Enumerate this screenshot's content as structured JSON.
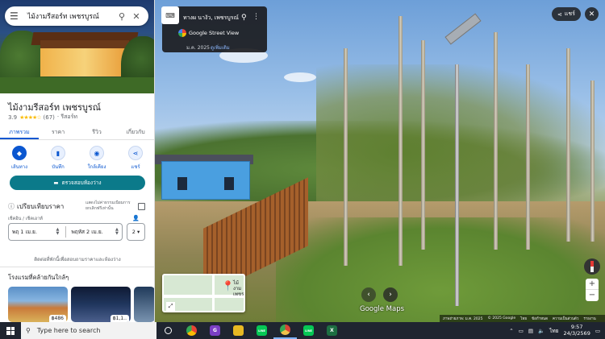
{
  "search": {
    "query": "ไม้งามรีสอร์ท เพชรบูรณ์",
    "menu_icon": "menu-icon",
    "search_icon": "search-icon",
    "close_icon": "close-icon"
  },
  "place": {
    "name": "ไม้งามรีสอร์ท เพชรบูรณ์",
    "rating": "3.9",
    "stars": "★★★★☆",
    "reviews": "(67)",
    "category": "· รีสอร์ท"
  },
  "tabs": [
    "ภาพรวม",
    "ราคา",
    "รีวิว",
    "เกี่ยวกับ"
  ],
  "actions": [
    {
      "label": "เส้นทาง",
      "icon": "directions-icon"
    },
    {
      "label": "บันทึก",
      "icon": "bookmark-icon"
    },
    {
      "label": "ใกล้เคียง",
      "icon": "nearby-icon"
    },
    {
      "label": "แชร์",
      "icon": "share-icon"
    }
  ],
  "check_button": "ตรวจสอบห้องว่าง",
  "compare": {
    "title": "เปรียบเทียบราคา",
    "hide_note": "แสดงไม่ค่าธรรมเนียมการยกเลิกฟรีเท่านั้น",
    "checkin_label": "เช็คอิน / เช็คเอาท์",
    "checkin": "พฤ 1 เม.ย.",
    "checkout": "พฤหัส 2 เม.ย.",
    "guests": "2",
    "price_msg": "ติดต่อที่พักนี้เพื่อสอบถามราคาและห้องว่าง"
  },
  "nearby": {
    "title": "โรงแรมที่คล้ายกันใกล้ๆ",
    "hotels": [
      {
        "price": "฿486"
      },
      {
        "price": "฿1,1.."
      },
      {
        "price": ""
      }
    ]
  },
  "street_view": {
    "location": "ทางผ นางัว, เพชรบูรณ์",
    "brand": "Google Street View",
    "date": "ม.ค. 2025",
    "view_more": "ดูเพิ่มเติม",
    "share": "แชร์",
    "maps_logo": "Google Maps",
    "minimap_label": "ไม้งาม เพชร",
    "attribution": [
      "ภาพถ่ายภาพ: ม.ค. 2025",
      "© 2025 Google",
      "ไทย",
      "ข้อกำหนด",
      "ความเป็นส่วนตัว",
      "รายงาน"
    ]
  },
  "taskbar": {
    "search_placeholder": "Type here to search",
    "apps": [
      {
        "name": "cortana-icon",
        "label": "○",
        "color": "#1f2530"
      },
      {
        "name": "chrome-icon",
        "label": "",
        "color": "#e0a800"
      },
      {
        "name": "app-g-icon",
        "label": "G",
        "color": "#7b3fc4"
      },
      {
        "name": "file-explorer-icon",
        "label": "",
        "color": "#e8b923"
      },
      {
        "name": "line-icon",
        "label": "LINE",
        "color": "#06c755"
      },
      {
        "name": "chrome-active-icon",
        "label": "",
        "color": "#d94535"
      },
      {
        "name": "line2-icon",
        "label": "LINE",
        "color": "#06c755"
      },
      {
        "name": "excel-icon",
        "label": "X",
        "color": "#1d6f42"
      }
    ],
    "lang": "ไทย",
    "time": "9:57",
    "date": "24/3/2569"
  }
}
